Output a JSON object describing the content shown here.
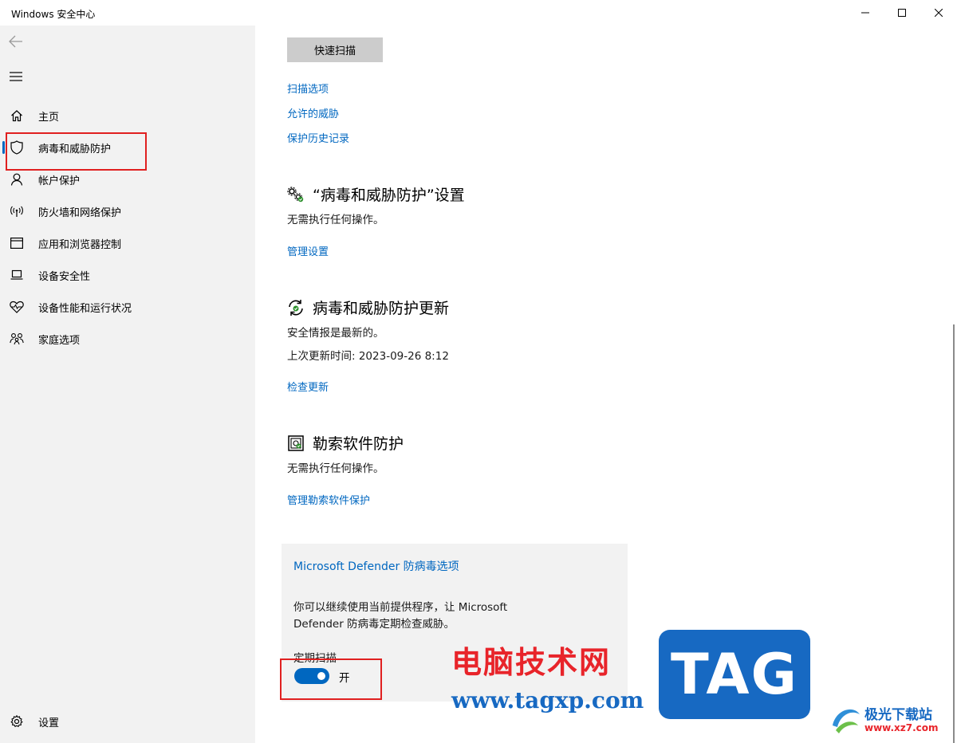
{
  "window": {
    "title": "Windows 安全中心"
  },
  "sidebar": {
    "items": [
      {
        "label": "主页",
        "icon": "home-icon"
      },
      {
        "label": "病毒和威胁防护",
        "icon": "shield-icon",
        "active": true
      },
      {
        "label": "帐户保护",
        "icon": "person-icon"
      },
      {
        "label": "防火墙和网络保护",
        "icon": "wifi-antenna-icon"
      },
      {
        "label": "应用和浏览器控制",
        "icon": "browser-window-icon"
      },
      {
        "label": "设备安全性",
        "icon": "laptop-icon"
      },
      {
        "label": "设备性能和运行状况",
        "icon": "heart-pulse-icon"
      },
      {
        "label": "家庭选项",
        "icon": "family-icon"
      }
    ],
    "settings_label": "设置"
  },
  "main": {
    "quick_scan_label": "快速扫描",
    "links": {
      "scan_options": "扫描选项",
      "allowed_threats": "允许的威胁",
      "protection_history": "保护历史记录"
    },
    "settings_section": {
      "title": "“病毒和威胁防护”设置",
      "status": "无需执行任何操作。",
      "link": "管理设置"
    },
    "updates_section": {
      "title": "病毒和威胁防护更新",
      "status": "安全情报是最新的。",
      "last_update": "上次更新时间: 2023-09-26 8:12",
      "link": "检查更新"
    },
    "ransomware_section": {
      "title": "勒索软件防护",
      "status": "无需执行任何操作。",
      "link": "管理勒索软件保护"
    },
    "defender_card": {
      "title": "Microsoft Defender 防病毒选项",
      "description": "你可以继续使用当前提供程序，让 Microsoft Defender 防病毒定期检查威胁。",
      "toggle_label": "定期扫描",
      "toggle_state": "开",
      "toggle_on": true
    }
  },
  "watermark": {
    "site_name": "电脑技术网",
    "site_url": "www.tagxp.com",
    "logo_text": "TAG",
    "brand2_name": "极光下载站",
    "brand2_url": "www.xz7.com"
  },
  "colors": {
    "accent": "#0067c0",
    "sidebar_bg": "#f2f2f2",
    "highlight": "#e02020"
  }
}
